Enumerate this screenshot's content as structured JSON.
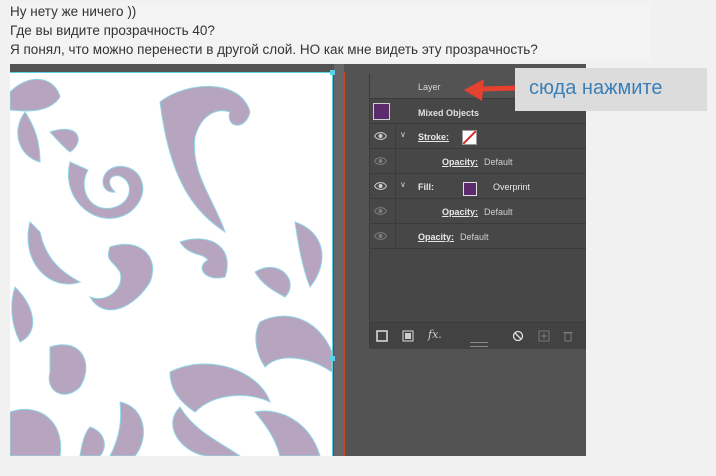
{
  "post": {
    "lines": [
      "Ну нету же ничего ))",
      "Где вы видите прозрачность 40?",
      "Я понял, что можно перенести в другой слой. НО как мне видеть эту прозрачность?"
    ]
  },
  "appearance_panel": {
    "header_label": "Layer",
    "object_label": "Mixed Objects",
    "stroke": {
      "label": "Stroke:",
      "opacity_label": "Opacity:",
      "opacity_value": "Default"
    },
    "fill": {
      "label": "Fill:",
      "mode": "Overprint",
      "opacity_label": "Opacity:",
      "opacity_value": "Default"
    },
    "object_opacity": {
      "label": "Opacity:",
      "value": "Default"
    },
    "footer": {
      "fx_label": "fx."
    }
  },
  "callout": {
    "text": "сюда нажмите"
  },
  "colors": {
    "pattern": "#b7a4be",
    "guide": "#5ad2e6",
    "fill_swatch": "#5b2b6e",
    "arrow": "#e4412f",
    "callout_text": "#3c7fb8"
  },
  "icons": [
    "eye-icon",
    "chevron-down-icon",
    "new-stroke-icon",
    "new-fill-icon",
    "fx-icon",
    "clear-icon",
    "duplicate-icon",
    "trash-icon"
  ]
}
